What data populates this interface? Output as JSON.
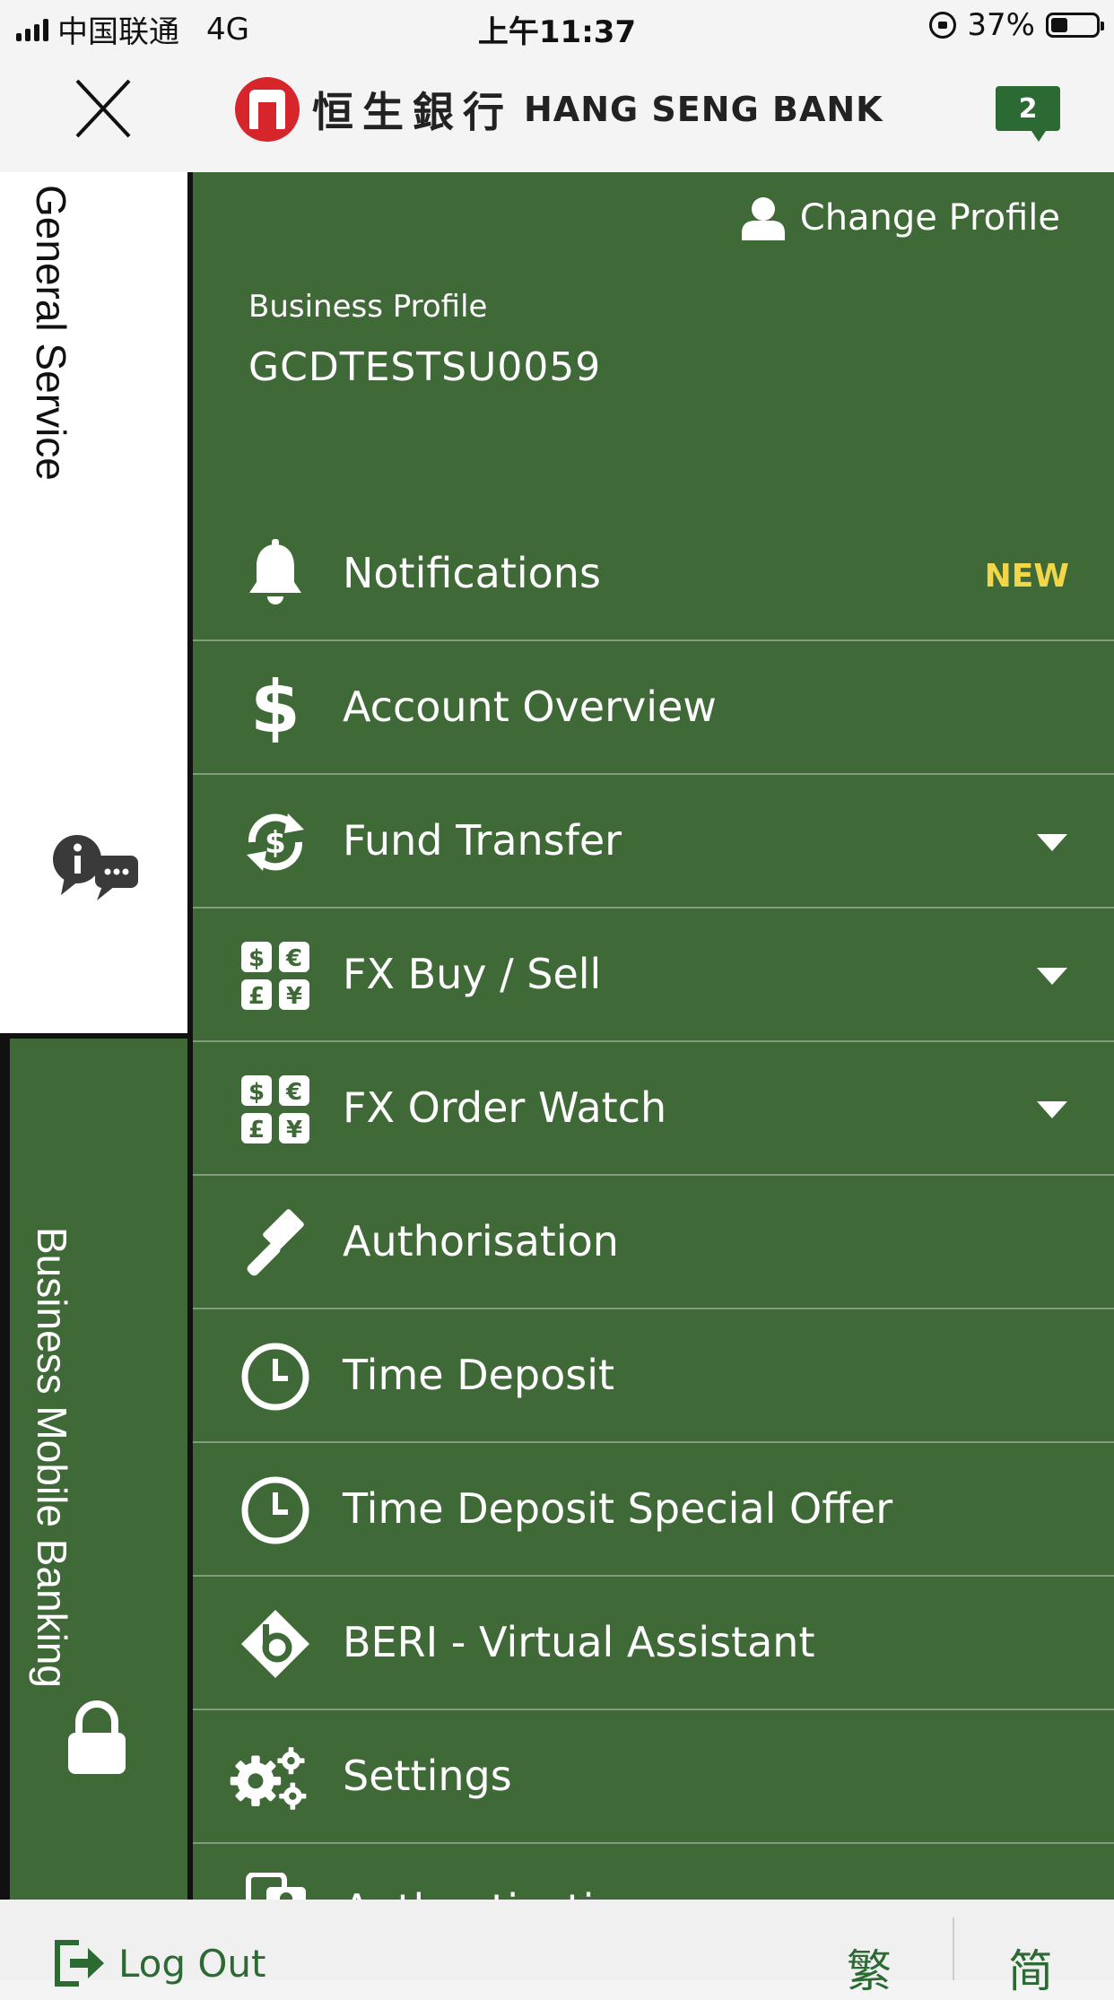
{
  "status_bar": {
    "carrier": "中国联通",
    "network": "4G",
    "time": "上午11:37",
    "battery": "37%",
    "battery_level": 0.37
  },
  "header": {
    "logo_cn": "恒生銀行",
    "logo_en": "HANG SENG BANK",
    "badge_count": "2"
  },
  "side_tabs": {
    "general": "General Service",
    "business": "Business Mobile Banking"
  },
  "profile": {
    "change_label": "Change Profile",
    "type_label": "Business Profile",
    "id": "GCDTESTSU0059"
  },
  "menu": [
    {
      "label": "Notifications",
      "icon": "bell-icon",
      "tag": "NEW"
    },
    {
      "label": "Account Overview",
      "icon": "dollar-icon"
    },
    {
      "label": "Fund Transfer",
      "icon": "transfer-icon",
      "expand": true
    },
    {
      "label": "FX Buy / Sell",
      "icon": "currency-icon",
      "expand": true
    },
    {
      "label": "FX Order Watch",
      "icon": "currency-icon",
      "expand": true
    },
    {
      "label": "Authorisation",
      "icon": "gavel-icon"
    },
    {
      "label": "Time Deposit",
      "icon": "clock-icon"
    },
    {
      "label": "Time Deposit Special Offer",
      "icon": "clock-icon"
    },
    {
      "label": "BERI - Virtual Assistant",
      "icon": "beri-icon"
    },
    {
      "label": "Settings",
      "icon": "gears-icon"
    },
    {
      "label": "Authentication",
      "icon": "phone-auth-icon"
    }
  ],
  "bottom": {
    "logout": "Log Out",
    "lang_traditional": "繁",
    "lang_simplified": "简"
  },
  "colors": {
    "brand_green": "#406938",
    "accent_green": "#2b6a33",
    "new_tag": "#f1d64a",
    "logo_red": "#d6262c"
  }
}
